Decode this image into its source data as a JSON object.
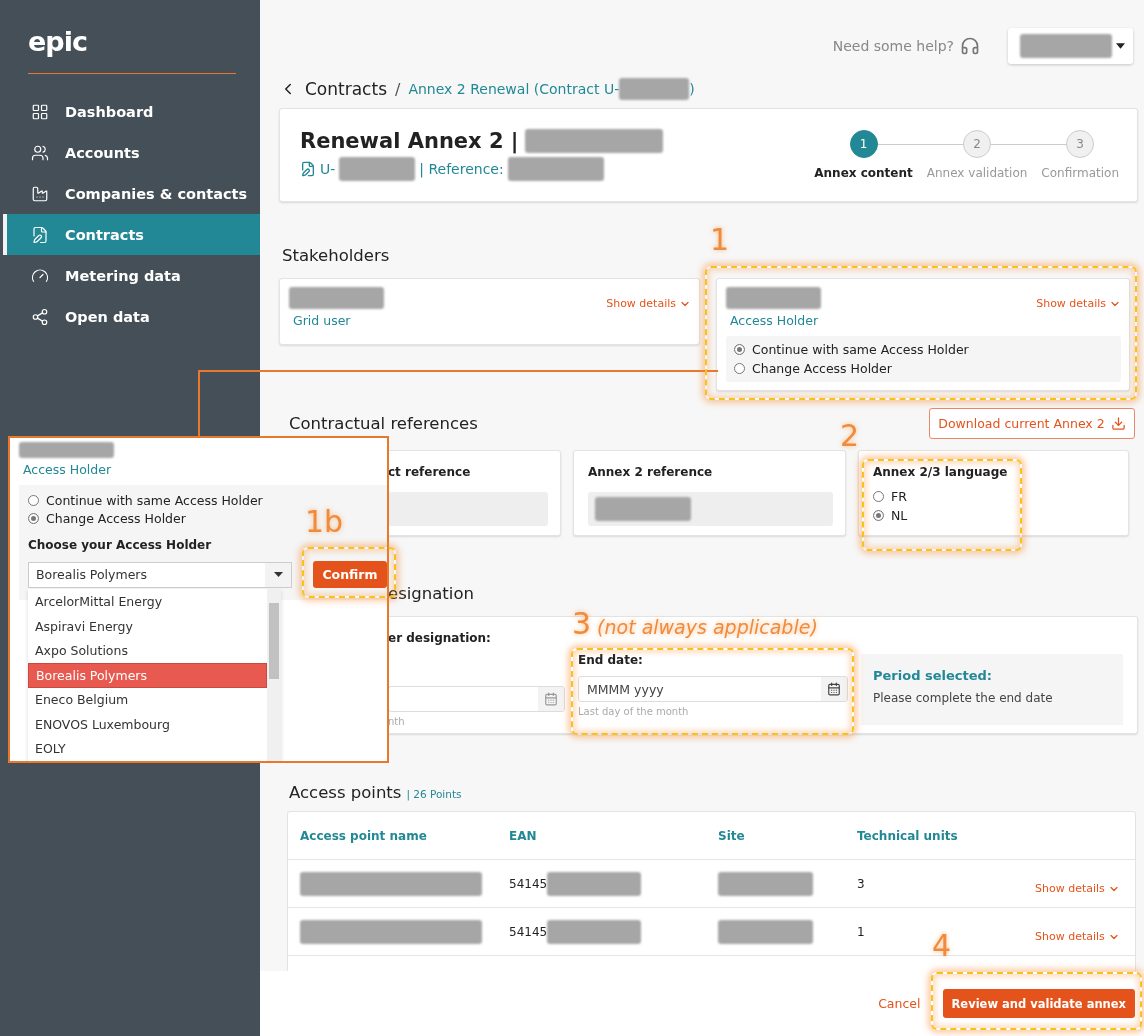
{
  "sidebar": {
    "logo": "epic",
    "items": [
      {
        "label": "Dashboard",
        "selected": false
      },
      {
        "label": "Accounts",
        "selected": false
      },
      {
        "label": "Companies & contacts",
        "selected": false
      },
      {
        "label": "Contracts",
        "selected": true
      },
      {
        "label": "Metering data",
        "selected": false
      },
      {
        "label": "Open data",
        "selected": false
      }
    ]
  },
  "topbar": {
    "help": "Need some help?"
  },
  "breadcrumb": {
    "parent": "Contracts",
    "separator": "/",
    "current_prefix": "Annex 2 Renewal (Contract U-",
    "current_suffix": ")"
  },
  "contract": {
    "title": "Renewal Annex 2 |",
    "id_prefix": "U-",
    "reference_label": "| Reference:"
  },
  "steps": [
    {
      "number": "1",
      "label": "Annex content",
      "selected": true
    },
    {
      "number": "2",
      "label": "Annex validation",
      "selected": false
    },
    {
      "number": "3",
      "label": "Confirmation",
      "selected": false
    }
  ],
  "stakeholders": {
    "title": "Stakeholders",
    "cards": [
      {
        "role": "Grid user",
        "toggle": "Show details"
      },
      {
        "role": "Access Holder",
        "toggle": "Show details",
        "options": [
          {
            "label": "Continue with same Access Holder",
            "selected": true
          },
          {
            "label": "Change Access Holder",
            "selected": false
          }
        ]
      }
    ]
  },
  "contractual_references": {
    "title": "Contractual references",
    "download": "Download current Annex 2",
    "contract_label": "ct reference",
    "annex_label": "Annex 2 reference",
    "language_label": "Annex 2/3 language",
    "languages": [
      {
        "label": "FR",
        "selected": false
      },
      {
        "label": "NL",
        "selected": true
      }
    ]
  },
  "designation": {
    "title": "esignation",
    "subtitle": "er designation:",
    "start_hint": "nth",
    "end_label": "End date:",
    "end_placeholder": "MMMM yyyy",
    "end_hint": "Last day of the month",
    "period_title": "Period selected:",
    "period_text": "Please complete the end date"
  },
  "access_points": {
    "title": "Access points",
    "count": "| 26 Points",
    "columns": [
      "Access point name",
      "EAN",
      "Site",
      "Technical units"
    ],
    "rows": [
      {
        "ean_prefix": "54145",
        "units": "3",
        "toggle": "Show details"
      },
      {
        "ean_prefix": "54145",
        "units": "1",
        "toggle": "Show details"
      }
    ]
  },
  "footer": {
    "cancel": "Cancel",
    "submit": "Review and validate annex"
  },
  "callout": {
    "role": "Access Holder",
    "options": [
      {
        "label": "Continue with same Access Holder",
        "selected": false
      },
      {
        "label": "Change Access Holder",
        "selected": true
      }
    ],
    "choose_label": "Choose your Access Holder",
    "select_value": "Borealis Polymers",
    "list": [
      {
        "label": "ArcelorMittal Energy",
        "selected": false
      },
      {
        "label": "Aspiravi Energy",
        "selected": false
      },
      {
        "label": "Axpo Solutions",
        "selected": false
      },
      {
        "label": "Borealis Polymers",
        "selected": true
      },
      {
        "label": "Eneco Belgium",
        "selected": false
      },
      {
        "label": "ENOVOS Luxembourg",
        "selected": false
      },
      {
        "label": "EOLY",
        "selected": false
      }
    ],
    "confirm": "Confirm"
  },
  "annotations": [
    {
      "label": "1"
    },
    {
      "label": "2"
    },
    {
      "label": "1b"
    },
    {
      "label": "3",
      "note": "(not always applicable)"
    },
    {
      "label": "4"
    }
  ]
}
